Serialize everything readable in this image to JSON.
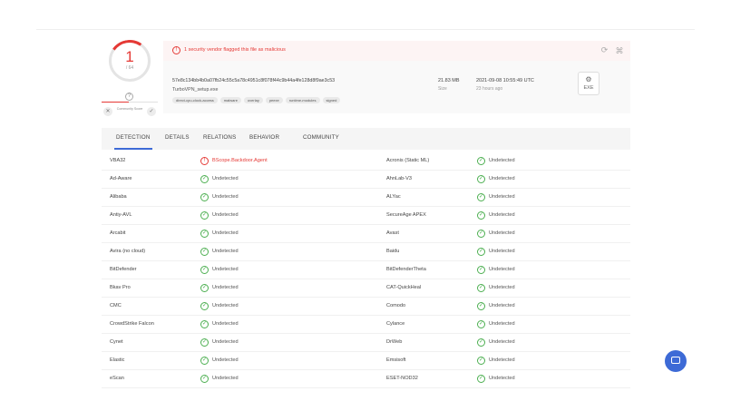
{
  "score": {
    "detections": "1",
    "total": "/ 64",
    "community_label": "Community Score",
    "unknown_glyph": "?"
  },
  "alert": {
    "text": "1 security vendor flagged this file as malicious"
  },
  "file": {
    "hash": "57e8c134bb4b0a07fb24c55c5a78c4951c8f078f44c9b44a4fe128d8f9ae3c53",
    "name": "TurboVPN_setup.exe",
    "tags": [
      "direct-cpu-clock-access",
      "malware",
      "overlay",
      "peexe",
      "runtime-modules",
      "signed"
    ],
    "size": "21.83 MB",
    "size_label": "Size",
    "date": "2021-09-08 10:55:49 UTC",
    "date_label": "23 hours ago",
    "type": "EXE"
  },
  "tabs": [
    "DETECTION",
    "DETAILS",
    "RELATIONS",
    "BEHAVIOR",
    "COMMUNITY"
  ],
  "detections": [
    {
      "left_vendor": "VBA32",
      "left_result": "BScope.Backdoor.Agent",
      "left_bad": true,
      "right_vendor": "Acronis (Static ML)",
      "right_result": "Undetected"
    },
    {
      "left_vendor": "Ad-Aware",
      "left_result": "Undetected",
      "left_bad": false,
      "right_vendor": "AhnLab-V3",
      "right_result": "Undetected"
    },
    {
      "left_vendor": "Alibaba",
      "left_result": "Undetected",
      "left_bad": false,
      "right_vendor": "ALYac",
      "right_result": "Undetected"
    },
    {
      "left_vendor": "Antiy-AVL",
      "left_result": "Undetected",
      "left_bad": false,
      "right_vendor": "SecureAge APEX",
      "right_result": "Undetected"
    },
    {
      "left_vendor": "Arcabit",
      "left_result": "Undetected",
      "left_bad": false,
      "right_vendor": "Avast",
      "right_result": "Undetected"
    },
    {
      "left_vendor": "Avira (no cloud)",
      "left_result": "Undetected",
      "left_bad": false,
      "right_vendor": "Baidu",
      "right_result": "Undetected"
    },
    {
      "left_vendor": "BitDefender",
      "left_result": "Undetected",
      "left_bad": false,
      "right_vendor": "BitDefenderTheta",
      "right_result": "Undetected"
    },
    {
      "left_vendor": "Bkav Pro",
      "left_result": "Undetected",
      "left_bad": false,
      "right_vendor": "CAT-QuickHeal",
      "right_result": "Undetected"
    },
    {
      "left_vendor": "CMC",
      "left_result": "Undetected",
      "left_bad": false,
      "right_vendor": "Comodo",
      "right_result": "Undetected"
    },
    {
      "left_vendor": "CrowdStrike Falcon",
      "left_result": "Undetected",
      "left_bad": false,
      "right_vendor": "Cylance",
      "right_result": "Undetected"
    },
    {
      "left_vendor": "Cynet",
      "left_result": "Undetected",
      "left_bad": false,
      "right_vendor": "DrWeb",
      "right_result": "Undetected"
    },
    {
      "left_vendor": "Elastic",
      "left_result": "Undetected",
      "left_bad": false,
      "right_vendor": "Emsisoft",
      "right_result": "Undetected"
    },
    {
      "left_vendor": "eScan",
      "left_result": "Undetected",
      "left_bad": false,
      "right_vendor": "ESET-NOD32",
      "right_result": "Undetected"
    }
  ],
  "icons": {
    "alert": "alert-circle-icon",
    "refresh": "refresh-icon",
    "graph": "graph-icon",
    "file_type": "exe-file-icon",
    "ok": "check-circle-icon",
    "bad": "alert-circle-icon",
    "chat": "chat-icon"
  },
  "colors": {
    "malicious": "#e53935",
    "clean": "#4caf50",
    "accent": "#3d6ad6"
  }
}
